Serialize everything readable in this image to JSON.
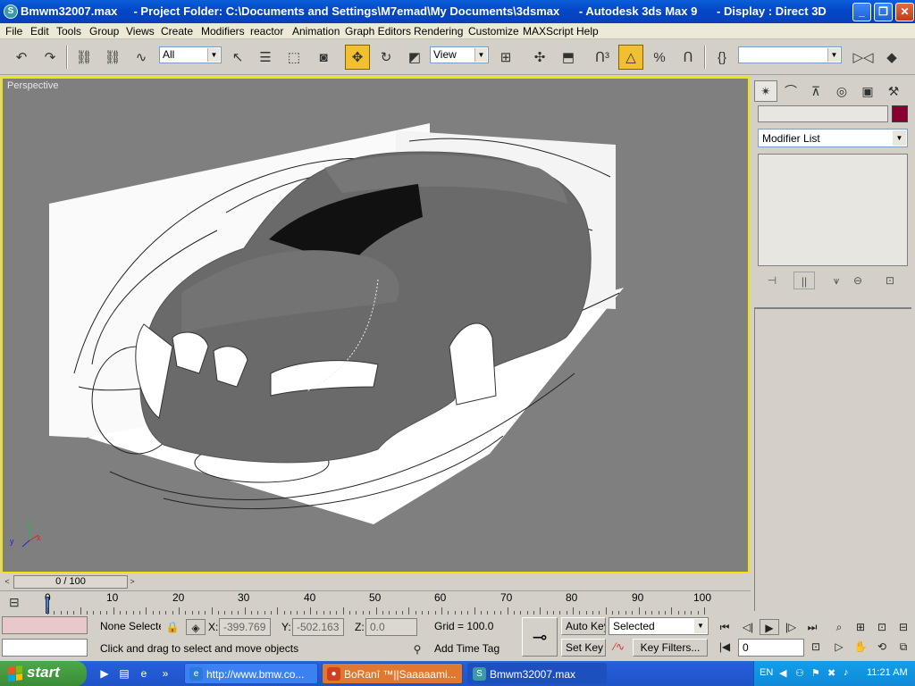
{
  "window": {
    "title": "Bmwm32007.max     - Project Folder: C:\\Documents and Settings\\M7emad\\My Documents\\3dsmax      - Autodesk 3ds Max 9      - Display : Direct 3D",
    "minimize": "_",
    "maximize": "❐",
    "close": "✕"
  },
  "menu": [
    "File",
    "Edit",
    "Tools",
    "Group",
    "Views",
    "Create",
    "Modifiers",
    "reactor",
    "Animation",
    "Graph Editors",
    "Rendering",
    "Customize",
    "MAXScript",
    "Help"
  ],
  "toolbar": {
    "selection_filter": "All",
    "ref_coord": "View",
    "named_selection": ""
  },
  "viewport": {
    "label": "Perspective",
    "axis_x": "x",
    "axis_y": "y",
    "axis_z": "z"
  },
  "command_panel": {
    "modifier_list": "Modifier List",
    "object_color": "#8a0030"
  },
  "timeline": {
    "frame_display": "0 / 100",
    "ticks": [
      "0",
      "10",
      "20",
      "30",
      "40",
      "50",
      "60",
      "70",
      "80",
      "90",
      "100"
    ]
  },
  "status": {
    "selection": "None Selecte",
    "x_label": "X:",
    "x_value": "-399.769",
    "y_label": "Y:",
    "y_value": "-502.163",
    "z_label": "Z:",
    "z_value": "0.0",
    "grid": "Grid = 100.0",
    "prompt": "Click and drag to select and move objects",
    "add_time_tag": "Add Time Tag",
    "auto_key": "Auto Key",
    "set_key": "Set Key",
    "key_mode": "Selected",
    "key_filters": "Key Filters...",
    "current_frame": "0"
  },
  "taskbar": {
    "start": "start",
    "tasks": [
      {
        "label": "http://www.bmw.co...",
        "active": false
      },
      {
        "label": "BoRanî ™||Saaaaami...",
        "active": false
      },
      {
        "label": "Bmwm32007.max",
        "active": true
      }
    ],
    "language": "EN",
    "clock": "11:21 AM"
  }
}
